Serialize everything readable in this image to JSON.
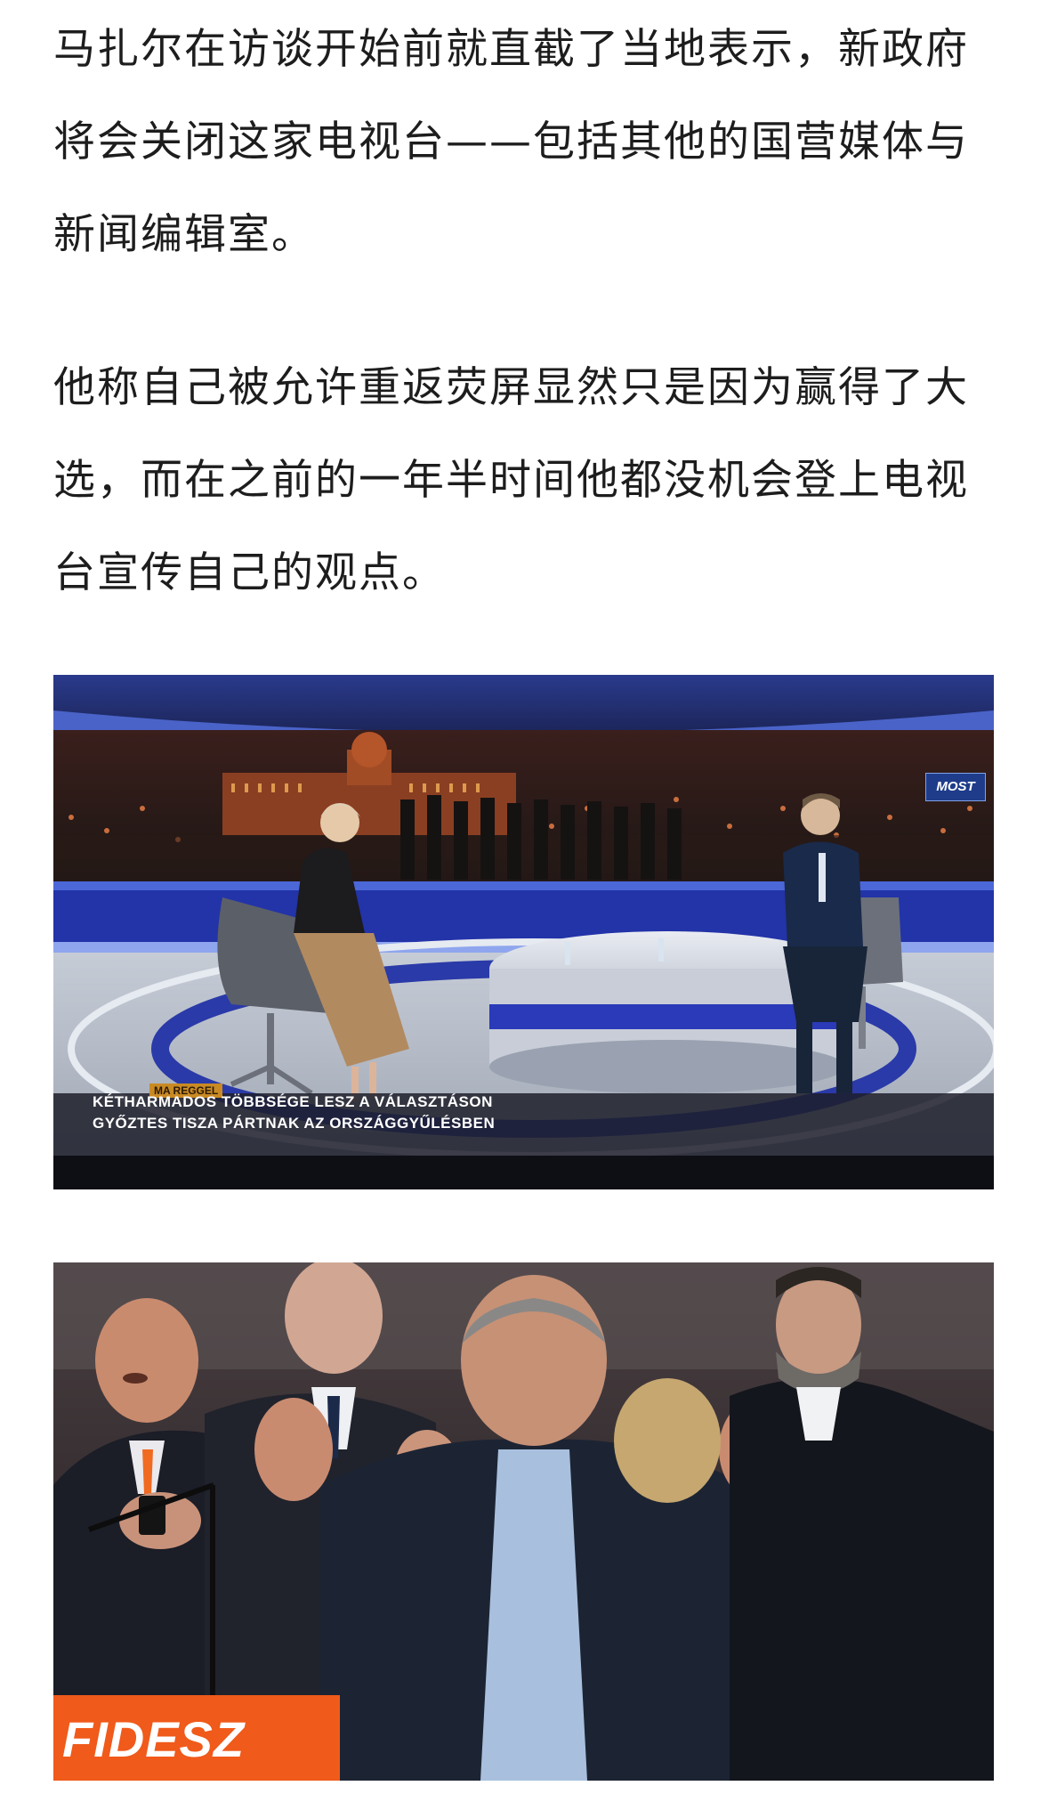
{
  "article": {
    "paragraphs": [
      "马扎尔在访谈开始前就直截了当地表示，新政府将会关闭这家电视台——包括其他的国营媒体与新闻编辑室。",
      "他称自己被允许重返荧屏显然只是因为赢得了大选，而在之前的一年半时间他都没机会登上电视台宣传自己的观点。"
    ]
  },
  "tv_image": {
    "ticker_tag": "MA REGGEL",
    "ticker_line1": "KÉTHARMADOS TÖBBSÉGE LESZ A VÁLASZTÁSON",
    "ticker_line2": "GYŐZTES TISZA PÁRTNAK AZ ORSZÁGGYŰLÉSBEN",
    "channel_logo": "MOST"
  },
  "rally_image": {
    "banner_text": "FIDESZ",
    "banner_color": "#f05a1a"
  }
}
